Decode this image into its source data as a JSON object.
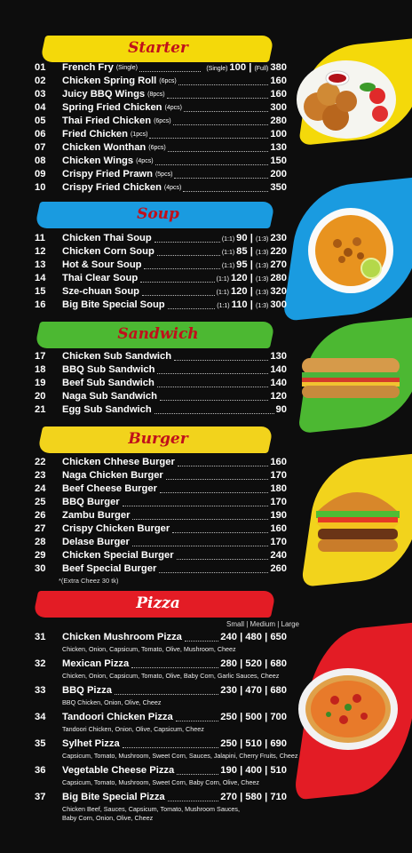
{
  "colors": {
    "starter": "#f4d90a",
    "soup": "#1a9be0",
    "sandwich": "#4cb832",
    "burger": "#f2d31c",
    "pizza": "#e31c25",
    "title": "#c0101b"
  },
  "starter": {
    "title": "Starter",
    "items": [
      {
        "no": "01",
        "name": "French Fry",
        "size": "(Single)",
        "price_single": "100",
        "size2": "(Full)",
        "price_full": "380"
      },
      {
        "no": "02",
        "name": "Chicken Spring Roll",
        "size": "(6pcs)",
        "price": "160"
      },
      {
        "no": "03",
        "name": "Juicy BBQ Wings",
        "size": "(8pcs)",
        "price": "160"
      },
      {
        "no": "04",
        "name": "Spring Fried Chicken",
        "size": "(4pcs)",
        "price": "300"
      },
      {
        "no": "05",
        "name": "Thai Fried Chicken",
        "size": "(6pcs)",
        "price": "280"
      },
      {
        "no": "06",
        "name": "Fried Chicken",
        "size": "(1pcs)",
        "price": "100"
      },
      {
        "no": "07",
        "name": "Chicken Wonthan",
        "size": "(6pcs)",
        "price": "130"
      },
      {
        "no": "08",
        "name": "Chicken Wings",
        "size": "(4pcs)",
        "price": "150"
      },
      {
        "no": "09",
        "name": "Crispy Fried Prawn",
        "size": "(5pcs)",
        "price": "200"
      },
      {
        "no": "10",
        "name": "Crispy Fried Chicken",
        "size": "(4pcs)",
        "price": "350"
      }
    ]
  },
  "soup": {
    "title": "Soup",
    "items": [
      {
        "no": "11",
        "name": "Chicken Thai Soup",
        "r1": "(1:1)",
        "p1": "90",
        "r2": "(1:3)",
        "p2": "230"
      },
      {
        "no": "12",
        "name": "Chicken Corn Soup",
        "r1": "(1:1)",
        "p1": "85",
        "r2": "(1:3)",
        "p2": "220"
      },
      {
        "no": "13",
        "name": "Hot & Sour Soup",
        "r1": "(1:1)",
        "p1": "95",
        "r2": "(1:3)",
        "p2": "270"
      },
      {
        "no": "14",
        "name": "Thai Clear Soup",
        "r1": "(1:1)",
        "p1": "120",
        "r2": "(1:3)",
        "p2": "280"
      },
      {
        "no": "15",
        "name": "Sze-chuan Soup",
        "r1": "(1:1)",
        "p1": "120",
        "r2": "(1:3)",
        "p2": "320"
      },
      {
        "no": "16",
        "name": "Big Bite Special Soup",
        "r1": "(1:1)",
        "p1": "110",
        "r2": "(1:3)",
        "p2": "300"
      }
    ]
  },
  "sandwich": {
    "title": "Sandwich",
    "items": [
      {
        "no": "17",
        "name": "Chicken Sub Sandwich",
        "price": "130"
      },
      {
        "no": "18",
        "name": "BBQ Sub Sandwich",
        "price": "140"
      },
      {
        "no": "19",
        "name": "Beef Sub Sandwich",
        "price": "140"
      },
      {
        "no": "20",
        "name": "Naga Sub Sandwich",
        "price": "120"
      },
      {
        "no": "21",
        "name": "Egg Sub Sandwich",
        "price": "90"
      }
    ]
  },
  "burger": {
    "title": "Burger",
    "items": [
      {
        "no": "22",
        "name": "Chicken Chhese Burger",
        "price": "160"
      },
      {
        "no": "23",
        "name": "Naga Chicken Burger",
        "price": "170"
      },
      {
        "no": "24",
        "name": "Beef Cheese Burger",
        "price": "180"
      },
      {
        "no": "25",
        "name": "BBQ Burger",
        "price": "170"
      },
      {
        "no": "26",
        "name": "Zambu Burger",
        "price": "190"
      },
      {
        "no": "27",
        "name": "Crispy Chicken Burger",
        "price": "160"
      },
      {
        "no": "28",
        "name": "Delase Burger",
        "price": "170"
      },
      {
        "no": "29",
        "name": "Chicken Special Burger",
        "price": "240"
      },
      {
        "no": "30",
        "name": "Beef Special Burger",
        "price": "260"
      }
    ],
    "note": "*(Extra Cheez 30 tk)"
  },
  "pizza": {
    "title": "Pizza",
    "sizes_header": "Small | Medium | Large",
    "items": [
      {
        "no": "31",
        "name": "Chicken Mushroom Pizza",
        "prices": "240 | 480 | 650",
        "ingredients": [
          "Chicken, Onion, Capsicum, Tomato, Olive, Mushroom, Cheez"
        ]
      },
      {
        "no": "32",
        "name": "Mexican Pizza",
        "prices": "280 | 520 | 680",
        "ingredients": [
          "Chicken, Onion, Capsicum, Tomato, Olive, Baby Corn, Garlic Sauces, Cheez"
        ]
      },
      {
        "no": "33",
        "name": "BBQ Pizza",
        "prices": "230 | 470 | 680",
        "ingredients": [
          "BBQ Chicken, Onion, Olive, Cheez"
        ]
      },
      {
        "no": "34",
        "name": "Tandoori Chicken Pizza",
        "prices": "250 | 500 | 700",
        "ingredients": [
          "Tandoori Chicken, Onion, Olive, Capsicum, Cheez"
        ]
      },
      {
        "no": "35",
        "name": "Sylhet Pizza",
        "prices": "250 | 510 | 690",
        "ingredients": [
          "Capsicum, Tomato, Mushroom, Sweet Corn, Sauces, Jalapini, Cherry Fruits, Cheez"
        ]
      },
      {
        "no": "36",
        "name": "Vegetable Cheese Pizza",
        "prices": "190 | 400 | 510",
        "ingredients": [
          "Capsicum, Tomato, Mushroom, Sweet Corn, Baby Corn, Olive, Cheez"
        ]
      },
      {
        "no": "37",
        "name": "Big Bite Special Pizza",
        "prices": "270 | 580 | 710",
        "ingredients": [
          "Chicken Beef, Sauces, Capsicum, Tomato, Mushroom Sauces,",
          "Baby Corn, Onion, Olive, Cheez"
        ]
      }
    ]
  }
}
